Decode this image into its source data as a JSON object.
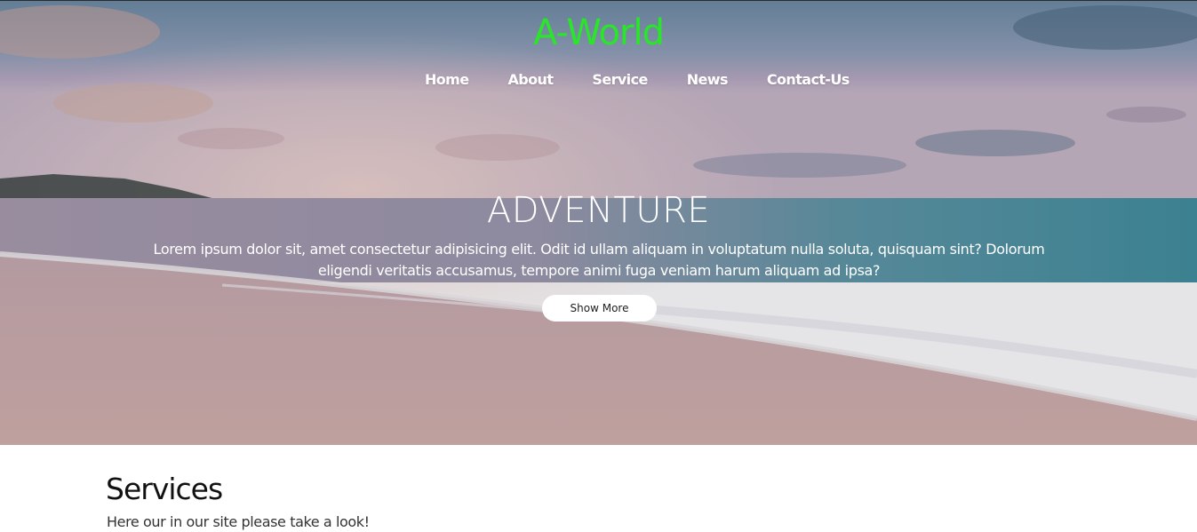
{
  "brand": {
    "title": "A-World",
    "color": "#29e629"
  },
  "nav": {
    "items": [
      {
        "label": "Home"
      },
      {
        "label": "About"
      },
      {
        "label": "Service"
      },
      {
        "label": "News"
      },
      {
        "label": "Contact-Us"
      }
    ]
  },
  "hero": {
    "title": "ADVENTURE",
    "text": "Lorem ipsum dolor sit, amet consectetur adipisicing elit. Odit id ullam aliquam in voluptatum nulla soluta, quisquam sint? Dolorum eligendi veritatis accusamus, tempore animi fuga veniam harum aliquam ad ipsa?",
    "button_label": "Show More"
  },
  "services": {
    "title": "Services",
    "subtitle": "Here our in our site please take a look!"
  }
}
